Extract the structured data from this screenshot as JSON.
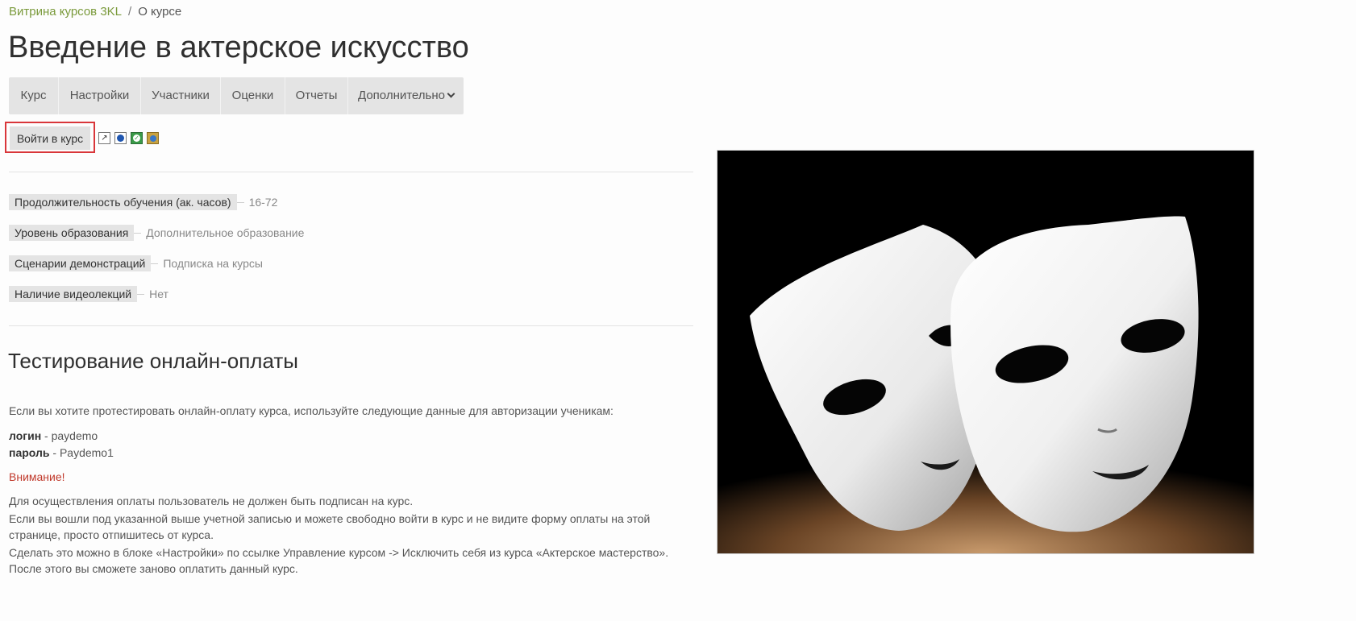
{
  "breadcrumb": {
    "items": [
      "Витрина курсов 3KL",
      "О курсе"
    ],
    "separator": "/"
  },
  "page_title": "Введение в актерское искусство",
  "course_nav": {
    "items": [
      "Курс",
      "Настройки",
      "Участники",
      "Оценки",
      "Отчеты",
      "Дополнительно"
    ]
  },
  "enrol": {
    "button_label": "Войти в курс",
    "icons": [
      "external-link-icon",
      "video-icon",
      "checkmark-icon",
      "circle-icon"
    ]
  },
  "fields": [
    {
      "label": "Продолжительность обучения (ак. часов)",
      "value": "16-72"
    },
    {
      "label": "Уровень образования",
      "value": "Дополнительное образование"
    },
    {
      "label": "Сценарии демонстраций",
      "value": "Подписка на курсы"
    },
    {
      "label": "Наличие видеолекций",
      "value": "Нет"
    }
  ],
  "section": {
    "title": "Тестирование онлайн-оплаты",
    "intro": "Если вы хотите протестировать онлайн-оплату курса, используйте следующие данные для авторизации ученикам:",
    "login_label": "логин",
    "login_value": "- paydemo",
    "password_label": "пароль",
    "password_value": "- Paydemo1",
    "warning": "Внимание!",
    "lines": [
      "Для осуществления оплаты пользователь не должен быть подписан на курс.",
      "Если вы вошли под указанной выше учетной записью и можете свободно войти в курс и не видите форму оплаты на этой",
      "странице, просто отпишитесь от курса.",
      "Сделать это можно в блоке «Настройки» по ссылке Управление курсом -> Исключить себя из курса «Актерское мастерство».",
      "После этого вы сможете заново оплатить данный курс."
    ]
  },
  "colors": {
    "link": "#7a9a3b",
    "warning": "#c0392b",
    "nav_bg": "#e4e4e4",
    "enrol_highlight": "#d9363a"
  },
  "image": {
    "subject": "theatre-masks-image"
  }
}
